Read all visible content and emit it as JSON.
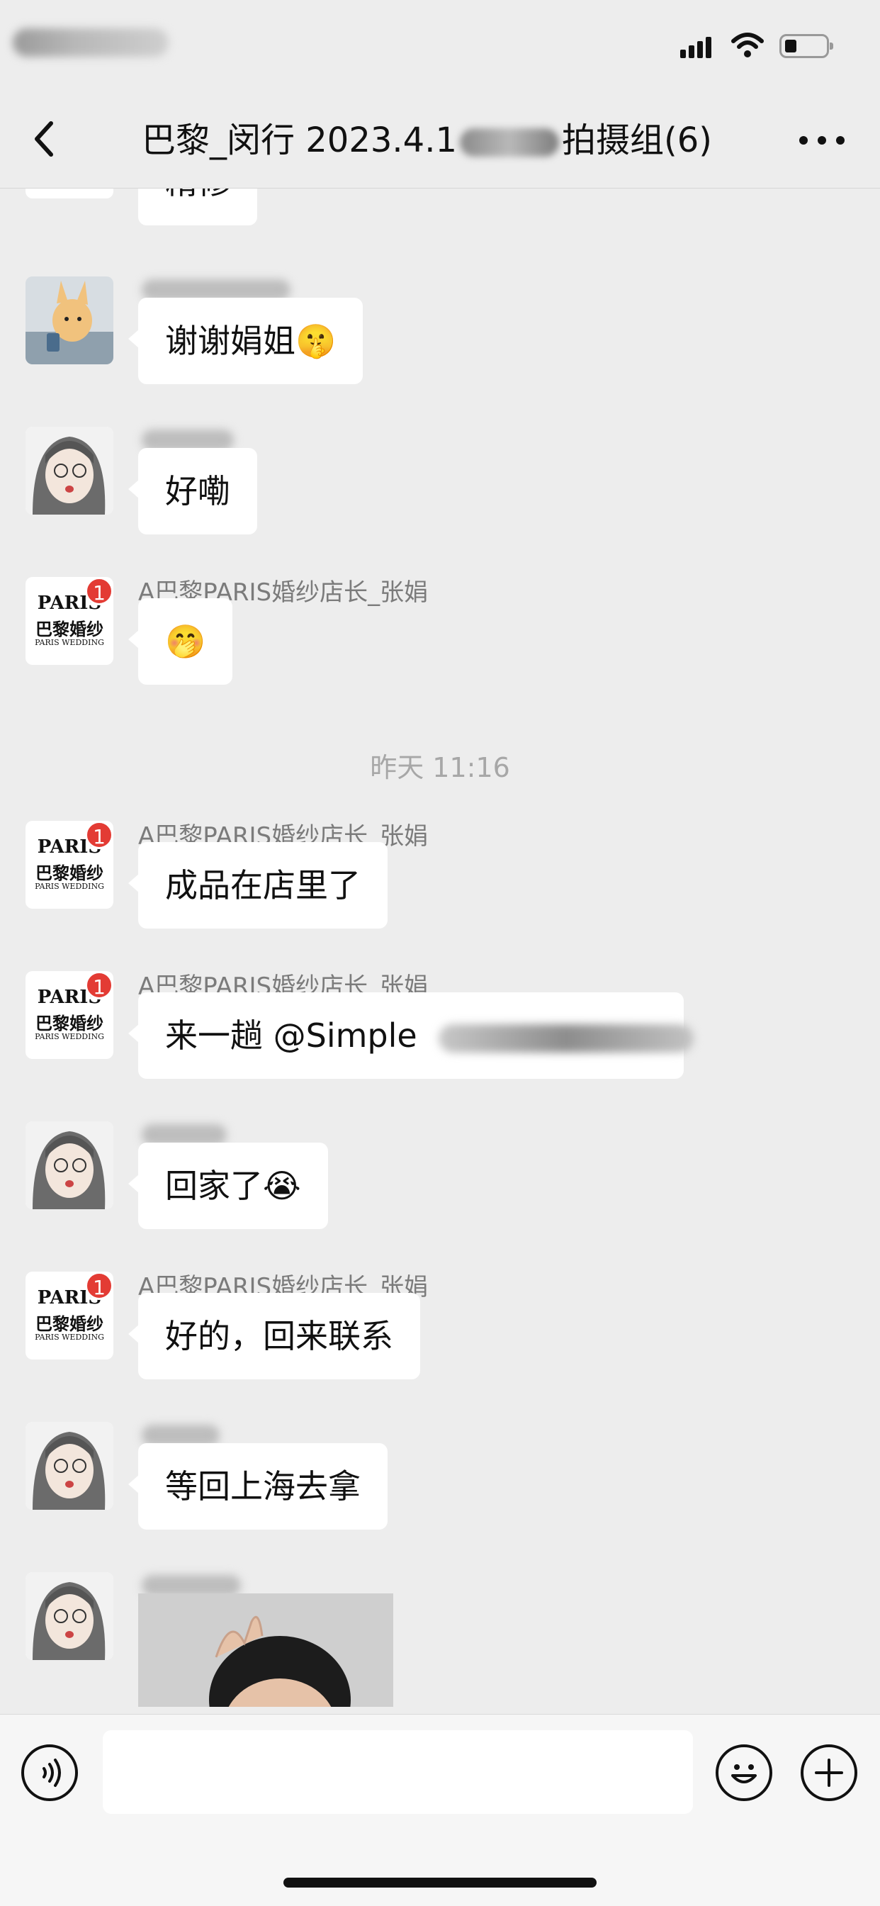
{
  "header": {
    "title_prefix": "巴黎_闵行 2023.4.1",
    "title_suffix": "拍摄组(6)"
  },
  "messages": [
    {
      "sender": "",
      "text": "精修"
    },
    {
      "sender": "",
      "text": "谢谢娟姐🤫"
    },
    {
      "sender": "",
      "text": "好嘞"
    },
    {
      "sender": "A巴黎PARIS婚纱店长_张娟",
      "text": "🤭"
    },
    {
      "timestamp": "昨天 11:16"
    },
    {
      "sender": "A巴黎PARIS婚纱店长_张娟",
      "text": "成品在店里了"
    },
    {
      "sender": "A巴黎PARIS婚纱店长_张娟",
      "text": "来一趟 @Simple"
    },
    {
      "sender": "",
      "text": "回家了😭"
    },
    {
      "sender": "A巴黎PARIS婚纱店长_张娟",
      "text": "好的，回来联系"
    },
    {
      "sender": "",
      "text": "等回上海去拿"
    },
    {
      "sender": "",
      "image": "photo"
    }
  ],
  "avatar": {
    "paris_top": "PARIS",
    "paris_mid": "巴黎婚纱",
    "paris_sub": "PARIS WEDDING",
    "badge_count": "1"
  },
  "icons": {
    "back": "chevron-left-icon",
    "more": "more-dots-icon",
    "voice": "voice-icon",
    "emoji": "emoji-icon",
    "plus": "plus-icon"
  },
  "colors": {
    "background": "#ededed",
    "bubble": "#ffffff",
    "badge": "#e33b34"
  }
}
